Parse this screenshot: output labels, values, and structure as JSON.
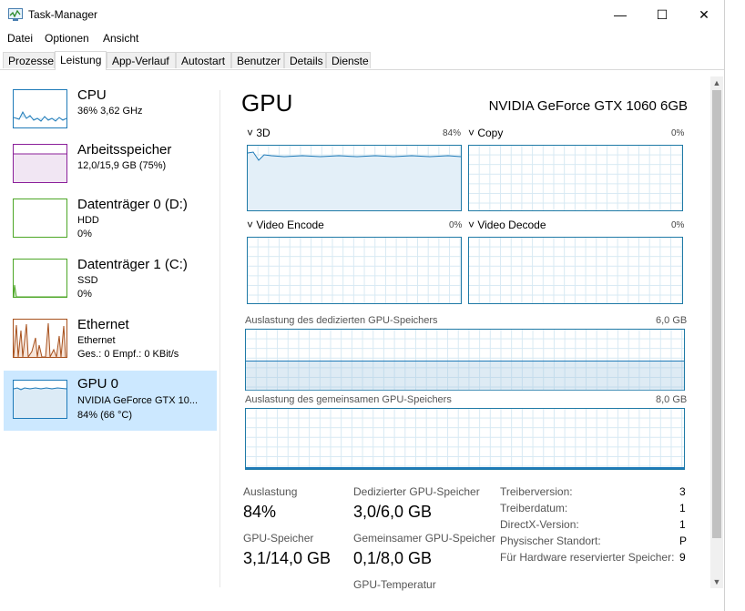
{
  "window": {
    "title": "Task-Manager",
    "minimize_glyph": "—",
    "maximize_glyph": "☐",
    "close_glyph": "✕"
  },
  "menu": [
    "Datei",
    "Optionen",
    "Ansicht"
  ],
  "tabs": [
    "Prozesse",
    "Leistung",
    "App-Verlauf",
    "Autostart",
    "Benutzer",
    "Details",
    "Dienste"
  ],
  "active_tab": "Leistung",
  "sidebar": [
    {
      "name": "CPU",
      "sub1": "36% 3,62 GHz",
      "color": "#1e7ab8"
    },
    {
      "name": "Arbeitsspeicher",
      "sub1": "12,0/15,9 GB (75%)",
      "color": "#8b1f9a"
    },
    {
      "name": "Datenträger 0 (D:)",
      "sub1": "HDD",
      "sub2": "0%",
      "color": "#4ca626"
    },
    {
      "name": "Datenträger 1 (C:)",
      "sub1": "SSD",
      "sub2": "0%",
      "color": "#4ca626"
    },
    {
      "name": "Ethernet",
      "sub1": "Ethernet",
      "sub2": "Ges.: 0 Empf.: 0 KBit/s",
      "color": "#a7501c"
    },
    {
      "name": "GPU 0",
      "sub1": "NVIDIA GeForce GTX 10...",
      "sub2": "84% (66 °C)",
      "color": "#1e7ab8",
      "selected": true
    }
  ],
  "main": {
    "title": "GPU",
    "model": "NVIDIA GeForce GTX 1060 6GB",
    "engines": [
      {
        "name": "3D",
        "pct": "84%"
      },
      {
        "name": "Copy",
        "pct": "0%"
      },
      {
        "name": "Video Encode",
        "pct": "0%"
      },
      {
        "name": "Video Decode",
        "pct": "0%"
      }
    ],
    "dedicated_label": "Auslastung des dedizierten GPU-Speichers",
    "dedicated_max": "6,0 GB",
    "shared_label": "Auslastung des gemeinsamen GPU-Speichers",
    "shared_max": "8,0 GB",
    "stats": {
      "auslastung_label": "Auslastung",
      "auslastung_value": "84%",
      "dedicated_label": "Dedizierter GPU-Speicher",
      "dedicated_value": "3,0/6,0 GB",
      "gpu_mem_label": "GPU-Speicher",
      "gpu_mem_value": "3,1/14,0 GB",
      "shared_label": "Gemeinsamer GPU-Speicher",
      "shared_value": "0,1/8,0 GB",
      "temp_label": "GPU-Temperatur"
    },
    "info": [
      {
        "key": "Treiberversion:",
        "value": "3"
      },
      {
        "key": "Treiberdatum:",
        "value": "1"
      },
      {
        "key": "DirectX-Version:",
        "value": "1"
      },
      {
        "key": "Physischer Standort:",
        "value": "P"
      },
      {
        "key": "Für Hardware reservierter Speicher:",
        "value": "9"
      }
    ]
  },
  "scroll": {
    "up": "▲",
    "down": "▼"
  }
}
